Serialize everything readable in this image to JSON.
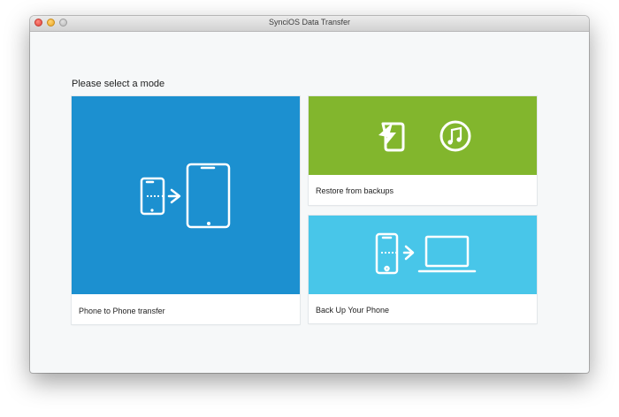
{
  "window": {
    "title": "SynciOS Data Transfer",
    "controls": [
      "close-button",
      "minimize-button",
      "zoom-button"
    ]
  },
  "main": {
    "heading": "Please select a mode",
    "modes": [
      {
        "label": "Phone to Phone transfer",
        "color": "#1c90d0",
        "icons": [
          "phone-to-phone-icon"
        ]
      },
      {
        "label": "Restore from backups",
        "color": "#82b62d",
        "icons": [
          "syncios-backup-icon",
          "itunes-music-icon"
        ]
      },
      {
        "label": "Back Up Your Phone",
        "color": "#48c6e9",
        "icons": [
          "phone-to-computer-icon"
        ]
      }
    ]
  }
}
